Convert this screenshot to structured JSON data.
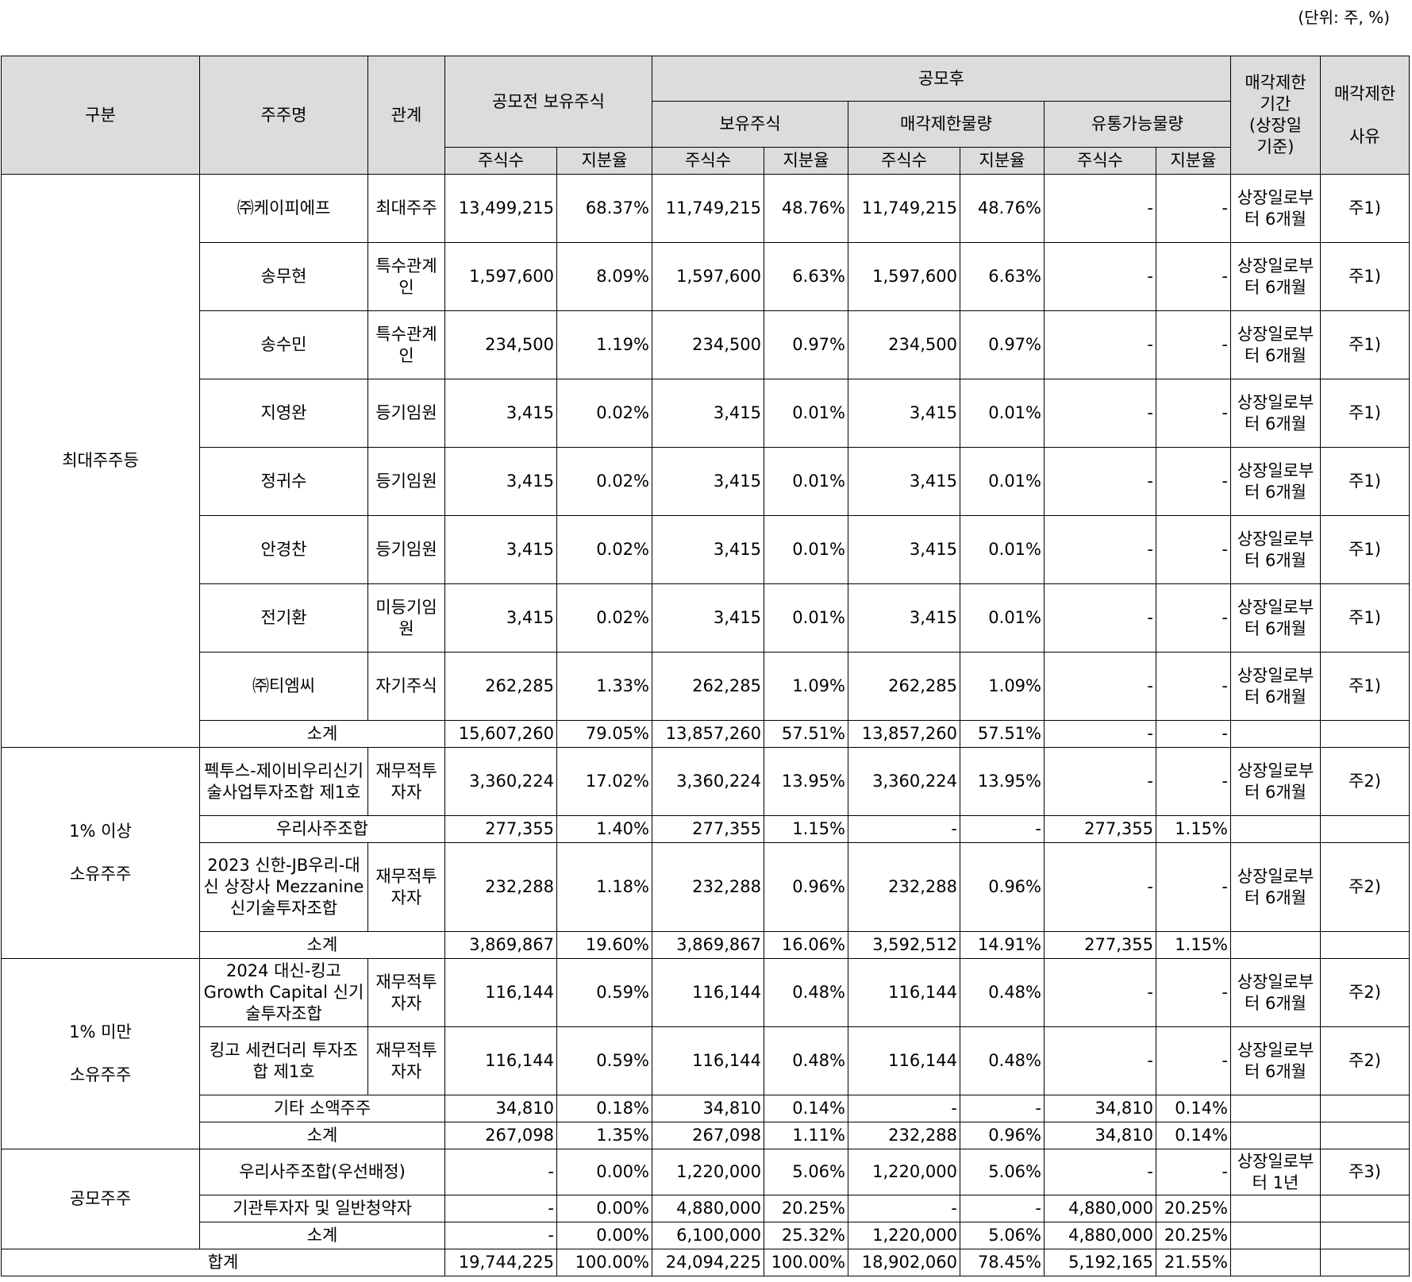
{
  "unit_note": "(단위: 주, %)",
  "header": {
    "category": "구분",
    "holder": "주주명",
    "relation": "관계",
    "pre_ipo": "공모전 보유주식",
    "post_ipo": "공모후",
    "held": "보유주식",
    "restricted": "매각제한물량",
    "tradable": "유통가능물량",
    "lockup_period_lines": [
      "매각제한",
      "기간",
      "(상장일",
      "기준)"
    ],
    "lockup_reason_lines": [
      "매각제한",
      "사유"
    ],
    "shares": "주식수",
    "ratio": "지분율"
  },
  "groups": {
    "g1": "최대주주등",
    "g2_lines": [
      "1% 이상",
      "소유주주"
    ],
    "g3_lines": [
      "1% 미만",
      "소유주주"
    ],
    "g4": "공모주주"
  },
  "rows": [
    {
      "name": "㈜케이피에프",
      "rel": "최대주주",
      "pre": "13,499,215",
      "pre_r": "68.37%",
      "held": "11,749,215",
      "held_r": "48.76%",
      "rest": "11,749,215",
      "rest_r": "48.76%",
      "trad": "-",
      "trad_r": "-",
      "period": "상장일로부터 6개월",
      "reason": "주1)"
    },
    {
      "name": "송무현",
      "rel": "특수관계인",
      "pre": "1,597,600",
      "pre_r": "8.09%",
      "held": "1,597,600",
      "held_r": "6.63%",
      "rest": "1,597,600",
      "rest_r": "6.63%",
      "trad": "-",
      "trad_r": "-",
      "period": "상장일로부터 6개월",
      "reason": "주1)"
    },
    {
      "name": "송수민",
      "rel": "특수관계인",
      "pre": "234,500",
      "pre_r": "1.19%",
      "held": "234,500",
      "held_r": "0.97%",
      "rest": "234,500",
      "rest_r": "0.97%",
      "trad": "-",
      "trad_r": "-",
      "period": "상장일로부터 6개월",
      "reason": "주1)"
    },
    {
      "name": "지영완",
      "rel": "등기임원",
      "pre": "3,415",
      "pre_r": "0.02%",
      "held": "3,415",
      "held_r": "0.01%",
      "rest": "3,415",
      "rest_r": "0.01%",
      "trad": "-",
      "trad_r": "-",
      "period": "상장일로부터 6개월",
      "reason": "주1)"
    },
    {
      "name": "정귀수",
      "rel": "등기임원",
      "pre": "3,415",
      "pre_r": "0.02%",
      "held": "3,415",
      "held_r": "0.01%",
      "rest": "3,415",
      "rest_r": "0.01%",
      "trad": "-",
      "trad_r": "-",
      "period": "상장일로부터 6개월",
      "reason": "주1)"
    },
    {
      "name": "안경찬",
      "rel": "등기임원",
      "pre": "3,415",
      "pre_r": "0.02%",
      "held": "3,415",
      "held_r": "0.01%",
      "rest": "3,415",
      "rest_r": "0.01%",
      "trad": "-",
      "trad_r": "-",
      "period": "상장일로부터 6개월",
      "reason": "주1)"
    },
    {
      "name": "전기환",
      "rel": "미등기임원",
      "pre": "3,415",
      "pre_r": "0.02%",
      "held": "3,415",
      "held_r": "0.01%",
      "rest": "3,415",
      "rest_r": "0.01%",
      "trad": "-",
      "trad_r": "-",
      "period": "상장일로부터 6개월",
      "reason": "주1)"
    },
    {
      "name": "㈜티엠씨",
      "rel": "자기주식",
      "pre": "262,285",
      "pre_r": "1.33%",
      "held": "262,285",
      "held_r": "1.09%",
      "rest": "262,285",
      "rest_r": "1.09%",
      "trad": "-",
      "trad_r": "-",
      "period": "상장일로부터 6개월",
      "reason": "주1)"
    },
    {
      "name": "소계",
      "pre": "15,607,260",
      "pre_r": "79.05%",
      "held": "13,857,260",
      "held_r": "57.51%",
      "rest": "13,857,260",
      "rest_r": "57.51%",
      "trad": "-",
      "trad_r": "-",
      "period": "",
      "reason": ""
    },
    {
      "name": "펙투스-제이비우리신기술사업투자조합 제1호",
      "rel": "재무적투자자",
      "pre": "3,360,224",
      "pre_r": "17.02%",
      "held": "3,360,224",
      "held_r": "13.95%",
      "rest": "3,360,224",
      "rest_r": "13.95%",
      "trad": "-",
      "trad_r": "-",
      "period": "상장일로부터 6개월",
      "reason": "주2)"
    },
    {
      "name": "우리사주조합",
      "pre": "277,355",
      "pre_r": "1.40%",
      "held": "277,355",
      "held_r": "1.15%",
      "rest": "-",
      "rest_r": "-",
      "trad": "277,355",
      "trad_r": "1.15%",
      "period": "",
      "reason": ""
    },
    {
      "name": "2023 신한-JB우리-대신 상장사 Mezzanine 신기술투자조합",
      "rel": "재무적투자자",
      "pre": "232,288",
      "pre_r": "1.18%",
      "held": "232,288",
      "held_r": "0.96%",
      "rest": "232,288",
      "rest_r": "0.96%",
      "trad": "-",
      "trad_r": "-",
      "period": "상장일로부터 6개월",
      "reason": "주2)"
    },
    {
      "name": "소계",
      "pre": "3,869,867",
      "pre_r": "19.60%",
      "held": "3,869,867",
      "held_r": "16.06%",
      "rest": "3,592,512",
      "rest_r": "14.91%",
      "trad": "277,355",
      "trad_r": "1.15%",
      "period": "",
      "reason": ""
    },
    {
      "name": "2024 대신-킹고 Growth Capital 신기술투자조합",
      "rel": "재무적투자자",
      "pre": "116,144",
      "pre_r": "0.59%",
      "held": "116,144",
      "held_r": "0.48%",
      "rest": "116,144",
      "rest_r": "0.48%",
      "trad": "-",
      "trad_r": "-",
      "period": "상장일로부터 6개월",
      "reason": "주2)"
    },
    {
      "name": "킹고 세컨더리 투자조합 제1호",
      "rel": "재무적투자자",
      "pre": "116,144",
      "pre_r": "0.59%",
      "held": "116,144",
      "held_r": "0.48%",
      "rest": "116,144",
      "rest_r": "0.48%",
      "trad": "-",
      "trad_r": "-",
      "period": "상장일로부터 6개월",
      "reason": "주2)"
    },
    {
      "name": "기타 소액주주",
      "pre": "34,810",
      "pre_r": "0.18%",
      "held": "34,810",
      "held_r": "0.14%",
      "rest": "-",
      "rest_r": "-",
      "trad": "34,810",
      "trad_r": "0.14%",
      "period": "",
      "reason": ""
    },
    {
      "name": "소계",
      "pre": "267,098",
      "pre_r": "1.35%",
      "held": "267,098",
      "held_r": "1.11%",
      "rest": "232,288",
      "rest_r": "0.96%",
      "trad": "34,810",
      "trad_r": "0.14%",
      "period": "",
      "reason": ""
    },
    {
      "name": "우리사주조합(우선배정)",
      "pre": "-",
      "pre_r": "0.00%",
      "held": "1,220,000",
      "held_r": "5.06%",
      "rest": "1,220,000",
      "rest_r": "5.06%",
      "trad": "-",
      "trad_r": "-",
      "period": "상장일로부터 1년",
      "reason": "주3)"
    },
    {
      "name": "기관투자자 및 일반청약자",
      "pre": "-",
      "pre_r": "0.00%",
      "held": "4,880,000",
      "held_r": "20.25%",
      "rest": "-",
      "rest_r": "-",
      "trad": "4,880,000",
      "trad_r": "20.25%",
      "period": "",
      "reason": ""
    },
    {
      "name": "소계",
      "pre": "-",
      "pre_r": "0.00%",
      "held": "6,100,000",
      "held_r": "25.32%",
      "rest": "1,220,000",
      "rest_r": "5.06%",
      "trad": "4,880,000",
      "trad_r": "20.25%",
      "period": "",
      "reason": ""
    },
    {
      "name": "합계",
      "pre": "19,744,225",
      "pre_r": "100.00%",
      "held": "24,094,225",
      "held_r": "100.00%",
      "rest": "18,902,060",
      "rest_r": "78.45%",
      "trad": "5,192,165",
      "trad_r": "21.55%",
      "period": "",
      "reason": ""
    }
  ]
}
